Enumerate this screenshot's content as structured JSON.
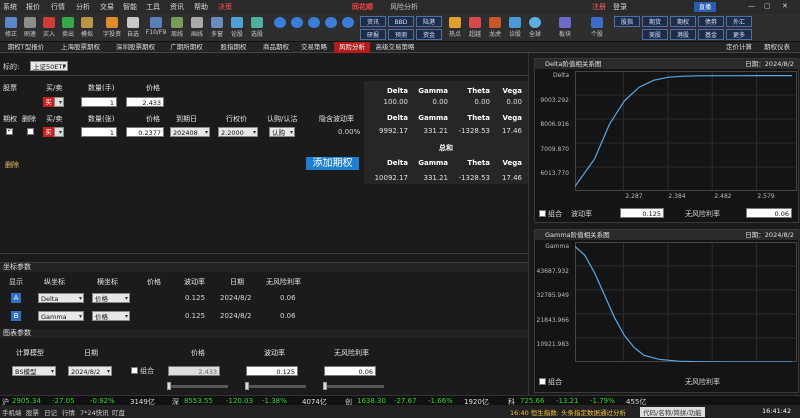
{
  "menu": {
    "items": [
      "系统",
      "报价",
      "行情",
      "分析",
      "交易",
      "智能",
      "工具",
      "资讯",
      "帮助",
      "决策"
    ],
    "brand": "同花顺",
    "window_title": "风险分析",
    "right_items": [
      "注册",
      "登录"
    ]
  },
  "toolbar": {
    "buttons": [
      "修正",
      "刷速",
      "买入",
      "卖出",
      "模拟",
      "字投资",
      "自选",
      "F10/F9",
      "周线",
      "画线",
      "多窗",
      "论股",
      "选股"
    ],
    "right_boxes": [
      "资讯",
      "BBD",
      "陆港",
      "研报",
      "预测",
      "资金",
      "热点",
      "超越",
      "龙虎",
      "诊股",
      "全球",
      "板块",
      "个股",
      "股指",
      "期货",
      "期权",
      "债券",
      "外汇",
      "美股",
      "港股",
      "基金",
      "更多"
    ],
    "right_box_pairs": [
      [
        "资讯",
        "BBD",
        "陆港"
      ],
      [
        "研报",
        "预测",
        "资金"
      ]
    ]
  },
  "tabs": {
    "items": [
      "期权T型报价",
      "上海股票期权",
      "深圳股票期权",
      "广期所期权",
      "股指期权",
      "商品期权",
      "交易策略",
      "风险分析",
      "高级交易策略"
    ],
    "active": "风险分析",
    "right_items": [
      "定价计算",
      "期权仪表"
    ]
  },
  "underlying": {
    "label": "标的:",
    "value": "上证50ETF"
  },
  "stock_section": {
    "headers": [
      "股票",
      "买/卖",
      "数量(手)",
      "价格"
    ],
    "side": "买",
    "quantity": "1",
    "price": "2.433"
  },
  "option_section": {
    "headers": [
      "期权",
      "删除",
      "买/卖",
      "数量(张)",
      "价格",
      "到期日",
      "行权价",
      "认购/认沽",
      "隐含波动率"
    ],
    "side": "买",
    "quantity": "1",
    "price": "0.2377",
    "expiry": "202408",
    "strike": "2.2000",
    "type": "认购",
    "iv": "0.00%",
    "delete_label": "删除",
    "add_button": "添加期权"
  },
  "greeks": {
    "headers": [
      "Delta",
      "Gamma",
      "Theta",
      "Vega"
    ],
    "stock_row": [
      "100.00",
      "0.00",
      "0.00",
      "0.00"
    ],
    "option_row": [
      "9992.17",
      "331.21",
      "-1328.53",
      "17.46"
    ],
    "total_label": "总和",
    "total_headers": [
      "Delta",
      "Gamma",
      "Theta",
      "Vega"
    ],
    "total_row": [
      "10092.17",
      "331.21",
      "-1328.53",
      "17.46"
    ]
  },
  "coord_params": {
    "title": "坐标参数",
    "headers": [
      "显示",
      "纵坐标",
      "横坐标",
      "价格",
      "波动率",
      "日期",
      "无风险利率"
    ],
    "rows": [
      {
        "id": "A",
        "y": "Delta",
        "x": "价格",
        "vol": "0.125",
        "date": "2024/8/2",
        "rate": "0.06"
      },
      {
        "id": "B",
        "y": "Gamma",
        "x": "价格",
        "vol": "0.125",
        "date": "2024/8/2",
        "rate": "0.06"
      }
    ]
  },
  "chart_params": {
    "title": "图表参数",
    "headers": [
      "计算模型",
      "日期",
      "价格",
      "波动率",
      "无风险利率"
    ],
    "model": "BS模型",
    "date": "2024/8/2",
    "combine": "组合",
    "price": "2.433",
    "vol": "0.125",
    "rate": "0.06"
  },
  "charts": [
    {
      "title": "Delta阶值相关系图",
      "date_label": "日期：2024/8/2",
      "y_name": "Delta",
      "yticks": [
        "9003.292",
        "8006.916",
        "7009.870",
        "6013.770"
      ],
      "xticks": [
        "2.287",
        "2.384",
        "2.482",
        "2.579"
      ],
      "combine": "组合",
      "vol_label": "波动率",
      "vol": "0.125",
      "rate_label": "无风险利率",
      "rate": "0.06"
    },
    {
      "title": "Gamma阶值相关系图",
      "date_label": "日期：2024/8/2",
      "y_name": "Gamma",
      "yticks": [
        "43687.932",
        "32785.949",
        "21843.966",
        "10921.983"
      ],
      "xticks": [
        "2.287",
        "2.384",
        "2.482",
        "2.579"
      ],
      "combine": "组合",
      "rate_label": "无风险利率"
    }
  ],
  "chart_data": [
    {
      "type": "line",
      "title": "Delta阶值相关系图",
      "series": [
        {
          "name": "Delta",
          "x": [
            2.19,
            2.23,
            2.26,
            2.29,
            2.32,
            2.35,
            2.38,
            2.41,
            2.44,
            2.48,
            2.52,
            2.56,
            2.6,
            2.63
          ],
          "y": [
            5200,
            6400,
            7900,
            8900,
            9500,
            9800,
            9930,
            9975,
            9990,
            9995,
            9998,
            9999,
            10000,
            10000
          ]
        }
      ],
      "ylim": [
        5000,
        10200
      ],
      "xlim": [
        2.19,
        2.64
      ]
    },
    {
      "type": "line",
      "title": "Gamma阶值相关系图",
      "series": [
        {
          "name": "Gamma",
          "x": [
            2.19,
            2.21,
            2.23,
            2.25,
            2.27,
            2.29,
            2.31,
            2.33,
            2.36,
            2.4,
            2.45,
            2.5,
            2.55,
            2.6,
            2.63
          ],
          "y": [
            52000,
            48000,
            40000,
            30000,
            20000,
            12000,
            6500,
            3000,
            1200,
            350,
            80,
            20,
            5,
            1,
            0
          ]
        }
      ],
      "ylim": [
        0,
        54000
      ],
      "xlim": [
        2.19,
        2.64
      ]
    }
  ],
  "status": {
    "items": [
      {
        "label": "沪",
        "value": "2905.34",
        "color": "#30d030"
      },
      {
        "label": "",
        "value": "-27.05",
        "color": "#30d030"
      },
      {
        "label": "",
        "value": "-0.92%",
        "color": "#30d030"
      },
      {
        "label": "",
        "value": "3149亿",
        "color": "#e0e0e0"
      },
      {
        "label": "深",
        "value": "8553.55",
        "color": "#30d030"
      },
      {
        "label": "",
        "value": "-120.03",
        "color": "#30d030"
      },
      {
        "label": "",
        "value": "-1.38%",
        "color": "#30d030"
      },
      {
        "label": "",
        "value": "4074亿",
        "color": "#e0e0e0"
      },
      {
        "label": "创",
        "value": "1638.30",
        "color": "#30d030"
      },
      {
        "label": "",
        "value": "-27.67",
        "color": "#30d030"
      },
      {
        "label": "",
        "value": "-1.66%",
        "color": "#30d030"
      },
      {
        "label": "",
        "value": "1920亿",
        "color": "#e0e0e0"
      },
      {
        "label": "科",
        "value": "725.66",
        "color": "#30d030"
      },
      {
        "label": "",
        "value": "-13.21",
        "color": "#30d030"
      },
      {
        "label": "",
        "value": "-1.79%",
        "color": "#30d030"
      },
      {
        "label": "",
        "value": "455亿",
        "color": "#e0e0e0"
      }
    ]
  },
  "bottom": {
    "left": [
      "手机端",
      "股票",
      "日记",
      "行情",
      "7*24快讯",
      "盯盘"
    ],
    "ticker": "16:40 恒生指数: 头条指定数据通过分析",
    "code_hint": "代码/名称/简拼/功能",
    "time": "16:41:42"
  },
  "colors": {
    "accent": "#1e7fd0",
    "active_tab": "#b31d1d",
    "down": "#30d030",
    "line": "#5aa8e8"
  }
}
